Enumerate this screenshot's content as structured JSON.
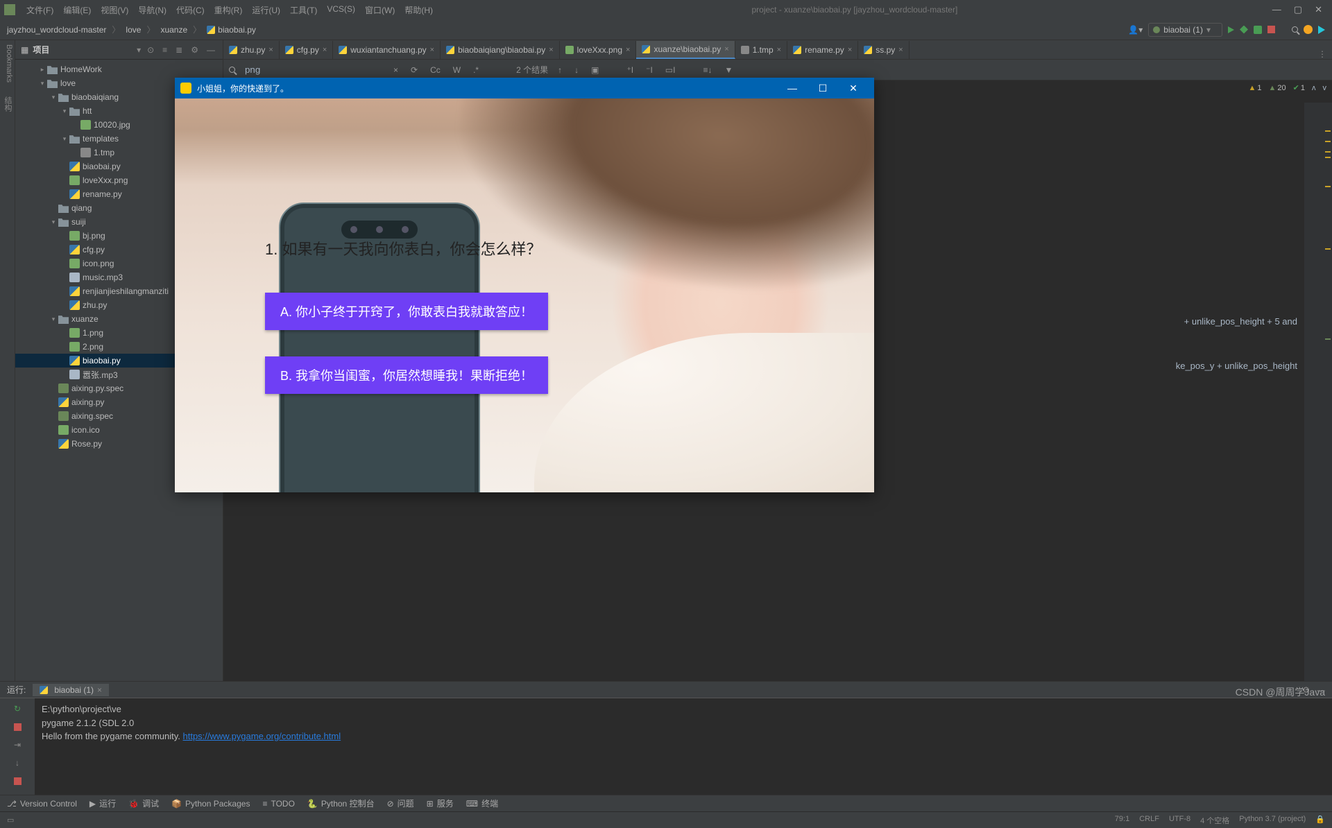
{
  "titlebar": {
    "menus": [
      "文件(F)",
      "编辑(E)",
      "视图(V)",
      "导航(N)",
      "代码(C)",
      "重构(R)",
      "运行(U)",
      "工具(T)",
      "VCS(S)",
      "窗口(W)",
      "帮助(H)"
    ],
    "title": "project - xuanze\\biaobai.py [jayzhou_wordcloud-master]"
  },
  "breadcrumb": [
    "jayzhou_wordcloud-master",
    "love",
    "xuanze",
    "biaobai.py"
  ],
  "run_config": "biaobai (1)",
  "project_panel": {
    "title": "项目"
  },
  "tree": [
    {
      "d": 2,
      "chev": ">",
      "icon": "folder",
      "label": "HomeWork"
    },
    {
      "d": 2,
      "chev": "v",
      "icon": "folder",
      "label": "love"
    },
    {
      "d": 3,
      "chev": "v",
      "icon": "folder",
      "label": "biaobaiqiang"
    },
    {
      "d": 4,
      "chev": "v",
      "icon": "folder",
      "label": "htt"
    },
    {
      "d": 5,
      "chev": "",
      "icon": "img",
      "label": "10020.jpg"
    },
    {
      "d": 4,
      "chev": "v",
      "icon": "folder",
      "label": "templates"
    },
    {
      "d": 5,
      "chev": "",
      "icon": "txt",
      "label": "1.tmp"
    },
    {
      "d": 4,
      "chev": "",
      "icon": "py",
      "label": "biaobai.py"
    },
    {
      "d": 4,
      "chev": "",
      "icon": "img",
      "label": "loveXxx.png"
    },
    {
      "d": 4,
      "chev": "",
      "icon": "py",
      "label": "rename.py"
    },
    {
      "d": 3,
      "chev": "",
      "icon": "folder",
      "label": "qiang"
    },
    {
      "d": 3,
      "chev": "v",
      "icon": "folder",
      "label": "suiji"
    },
    {
      "d": 4,
      "chev": "",
      "icon": "img",
      "label": "bj.png"
    },
    {
      "d": 4,
      "chev": "",
      "icon": "py",
      "label": "cfg.py"
    },
    {
      "d": 4,
      "chev": "",
      "icon": "img",
      "label": "icon.png"
    },
    {
      "d": 4,
      "chev": "",
      "icon": "mp3",
      "label": "music.mp3"
    },
    {
      "d": 4,
      "chev": "",
      "icon": "py",
      "label": "renjianjieshilangmanziti"
    },
    {
      "d": 4,
      "chev": "",
      "icon": "py",
      "label": "zhu.py"
    },
    {
      "d": 3,
      "chev": "v",
      "icon": "folder",
      "label": "xuanze"
    },
    {
      "d": 4,
      "chev": "",
      "icon": "img",
      "label": "1.png"
    },
    {
      "d": 4,
      "chev": "",
      "icon": "img",
      "label": "2.png"
    },
    {
      "d": 4,
      "chev": "",
      "icon": "py",
      "label": "biaobai.py",
      "sel": true
    },
    {
      "d": 4,
      "chev": "",
      "icon": "mp3",
      "label": "嚣张.mp3"
    },
    {
      "d": 3,
      "chev": "",
      "icon": "spec",
      "label": "aixing.py.spec"
    },
    {
      "d": 3,
      "chev": "",
      "icon": "py",
      "label": "aixing.py"
    },
    {
      "d": 3,
      "chev": "",
      "icon": "spec",
      "label": "aixing.spec"
    },
    {
      "d": 3,
      "chev": "",
      "icon": "img",
      "label": "icon.ico"
    },
    {
      "d": 3,
      "chev": "",
      "icon": "py",
      "label": "Rose.py"
    }
  ],
  "tabs": [
    {
      "icon": "py",
      "label": "zhu.py"
    },
    {
      "icon": "py",
      "label": "cfg.py"
    },
    {
      "icon": "py",
      "label": "wuxiantanchuang.py"
    },
    {
      "icon": "py",
      "label": "biaobaiqiang\\biaobai.py"
    },
    {
      "icon": "img",
      "label": "loveXxx.png"
    },
    {
      "icon": "py",
      "label": "xuanze\\biaobai.py",
      "active": true
    },
    {
      "icon": "txt",
      "label": "1.tmp"
    },
    {
      "icon": "py",
      "label": "rename.py"
    },
    {
      "icon": "py",
      "label": "ss.py"
    }
  ],
  "find": {
    "query": "png",
    "results": "2 个结果"
  },
  "inspections": {
    "warn1": "1",
    "warn2": "20",
    "ok": "1"
  },
  "code": {
    "l1": " + unlike_pos_height + 5 and",
    "l2": "ke_pos_y + unlike_pos_height"
  },
  "run_tool": {
    "label": "运行:",
    "tab": "biaobai (1)"
  },
  "console": {
    "l1": "E:\\python\\project\\ve",
    "l2": "pygame 2.1.2 (SDL 2.0",
    "l3": "Hello from the pygame community. ",
    "link": "https://www.pygame.org/contribute.html"
  },
  "bottombar": [
    "Version Control",
    "运行",
    "调试",
    "Python Packages",
    "TODO",
    "Python 控制台",
    "问题",
    "服务",
    "终端"
  ],
  "status": {
    "pos": "79:1",
    "eol": "CRLF",
    "enc": "UTF-8",
    "indent": "4 个空格",
    "interp": "Python 3.7 (project)"
  },
  "watermark": "CSDN @周周学Java",
  "pygame": {
    "title": "小姐姐，你的快递到了。",
    "question": "1. 如果有一天我向你表白，你会怎么样？",
    "optA": "A. 你小子终于开窍了，你敢表白我就敢答应！",
    "optB": "B. 我拿你当闺蜜，你居然想睡我！果断拒绝！"
  }
}
